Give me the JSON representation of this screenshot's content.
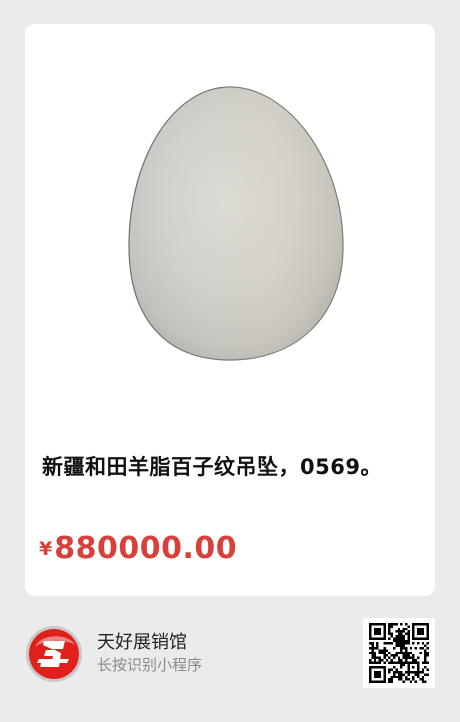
{
  "product": {
    "image_icon": "jade-egg-pendant-image",
    "title": "新疆和田羊脂百子纹吊坠，0569。",
    "currency_symbol": "¥",
    "price": "880000.00"
  },
  "shop": {
    "logo_icon": "shop-logo-icon",
    "name": "天好展销馆",
    "hint": "长按识别小程序",
    "qr_icon": "qr-code-icon"
  },
  "colors": {
    "background": "#ebebeb",
    "card": "#ffffff",
    "price": "#d8403b",
    "logo_red": "#e1201b"
  }
}
